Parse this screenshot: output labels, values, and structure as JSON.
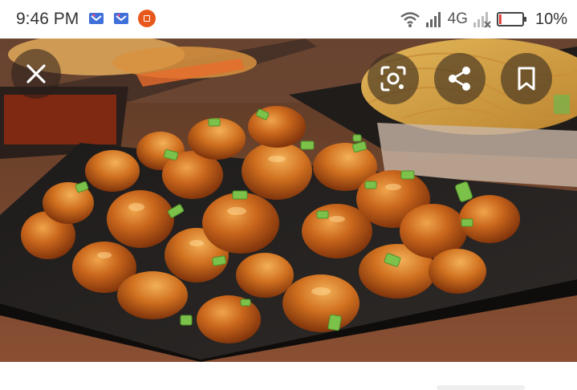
{
  "status_bar": {
    "time": "9:46 PM",
    "network": "4G",
    "battery_percent": "10%",
    "battery_level": 0.1,
    "battery_color": "#e53935"
  },
  "viewer": {
    "icons": [
      "close-icon",
      "lens-icon",
      "share-icon",
      "bookmark-icon"
    ]
  },
  "colors": {
    "app_icon": "#e8581c",
    "overlay_button": "rgba(60,45,30,0.62)"
  }
}
